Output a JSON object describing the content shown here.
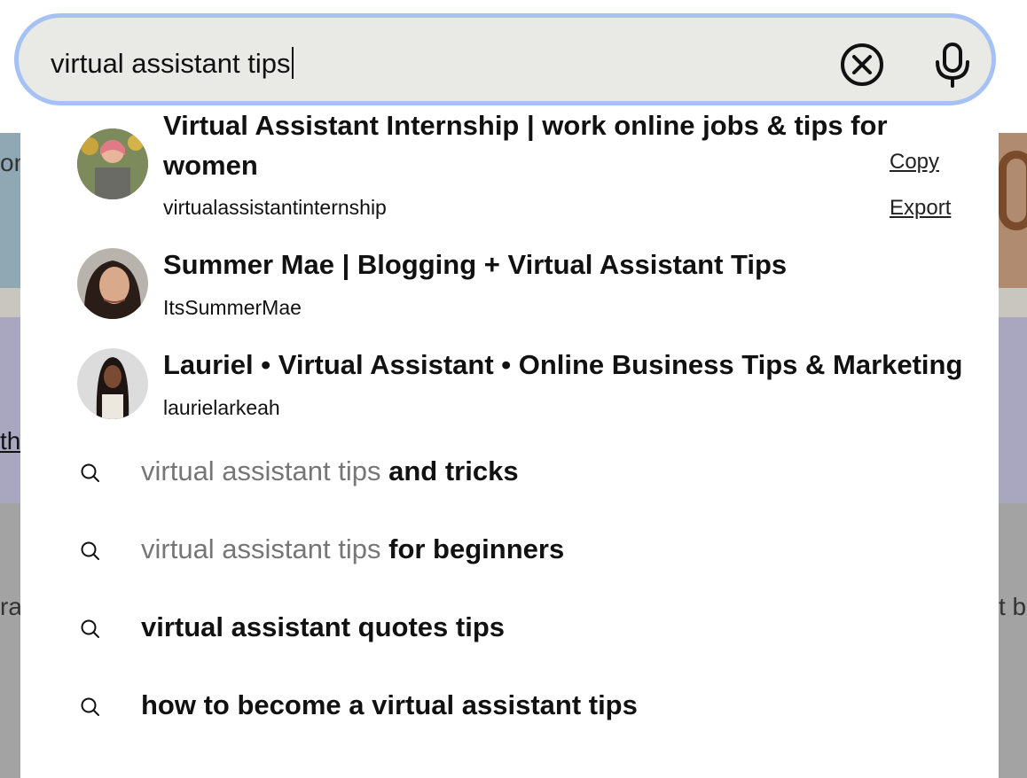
{
  "search": {
    "query": "virtual assistant tips"
  },
  "dropdown": {
    "profiles": [
      {
        "title": "Virtual Assistant Internship | work online jobs & tips for women",
        "handle": "virtualassistantinternship"
      },
      {
        "title": "Summer Mae | Blogging + Virtual Assistant Tips",
        "handle": "ItsSummerMae"
      },
      {
        "title": "Lauriel • Virtual Assistant • Online Business Tips & Marketing",
        "handle": "laurielarkeah"
      }
    ],
    "context_menu": {
      "copy": "Copy",
      "export": "Export"
    },
    "suggestions": [
      {
        "typed": "virtual assistant tips",
        "completion": "and tricks"
      },
      {
        "typed": "virtual assistant tips",
        "completion": "for beginners"
      },
      {
        "typed": "",
        "completion": "virtual assistant quotes tips"
      },
      {
        "typed": "",
        "completion": "how to become a virtual assistant tips"
      }
    ]
  },
  "background": {
    "fragments": [
      "on",
      "th",
      "ra",
      "t b"
    ]
  },
  "colors": {
    "search_border": "#a6c2f5",
    "search_fill": "#e9e9e6",
    "typed_prefix": "#767676"
  }
}
